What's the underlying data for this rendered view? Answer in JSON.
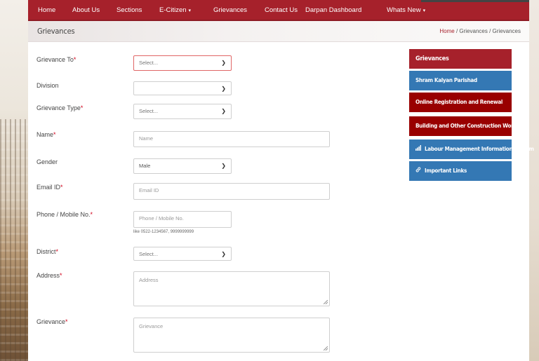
{
  "nav": {
    "items": [
      {
        "label": "Home"
      },
      {
        "label": "About Us"
      },
      {
        "label": "Sections"
      },
      {
        "label": "E-Citizen",
        "dropdown": true
      },
      {
        "label": "Grievances"
      },
      {
        "label": "Contact Us"
      },
      {
        "label": "Darpan Dashboard"
      },
      {
        "label": "Whats New",
        "dropdown": true
      }
    ],
    "caret": "▾"
  },
  "page": {
    "title": "Grievances",
    "breadcrumb": {
      "home": "Home",
      "sep1": " / ",
      "middle": "Grievances",
      "sep2": " / ",
      "current": "Grievances"
    }
  },
  "form": {
    "required_mark": "*",
    "grievance_to": {
      "label": "Grievance To",
      "value": "Select..."
    },
    "division": {
      "label": "Division",
      "value": ""
    },
    "grievance_type": {
      "label": "Grievance Type",
      "value": "Select..."
    },
    "name": {
      "label": "Name",
      "placeholder": "Name"
    },
    "gender": {
      "label": "Gender",
      "value": "Male"
    },
    "email": {
      "label": "Email ID",
      "placeholder": "Email ID"
    },
    "phone": {
      "label": "Phone / Mobile No.",
      "placeholder": "Phone / Mobile No.",
      "hint": "like 0522-1234567, 9999999999"
    },
    "district": {
      "label": "District",
      "value": "Select..."
    },
    "address": {
      "label": "Address",
      "placeholder": "Address"
    },
    "grievance": {
      "label": "Grievance",
      "placeholder": "Grievance"
    }
  },
  "sidebar": {
    "header": "Grievances",
    "items": [
      {
        "label": "Shram Kalyan Parishad",
        "icon": "",
        "color": "#3478b4"
      },
      {
        "label": "Online Registration and Renewal",
        "icon": "",
        "color": "#990000"
      },
      {
        "label": "Building and Other Construction Workers",
        "icon": "",
        "color": "#990000"
      },
      {
        "label": "Labour Management Information System",
        "icon": "bar-chart-icon",
        "color": "#3478b4"
      },
      {
        "label": "Important Links",
        "icon": "link-icon",
        "color": "#3478b4"
      }
    ]
  },
  "colors": {
    "brand": "#a6212b",
    "blue": "#3478b4",
    "dark_red": "#990000"
  }
}
